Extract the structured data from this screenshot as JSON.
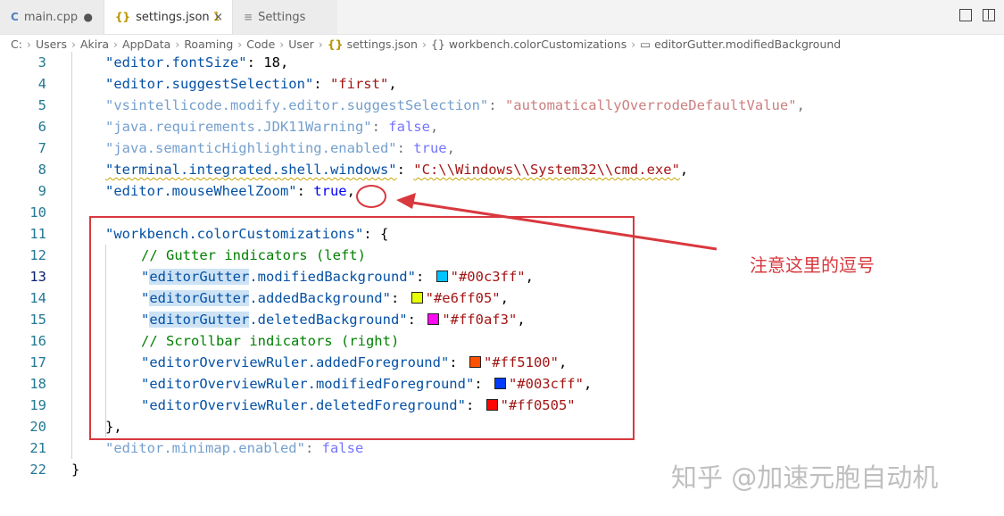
{
  "tabs": [
    {
      "icon": "C",
      "label": "main.cpp",
      "marker": "●"
    },
    {
      "icon": "{}",
      "label": "settings.json",
      "badge": "1",
      "marker": "×"
    },
    {
      "icon": "≡",
      "label": "Settings"
    }
  ],
  "breadcrumb": [
    "C:",
    "Users",
    "Akira",
    "AppData",
    "Roaming",
    "Code",
    "User",
    "settings.json",
    "{} workbench.colorCustomizations",
    "editorGutter.modifiedBackground"
  ],
  "breadcrumb_json_icon": "{}",
  "lines": [
    {
      "num": "3",
      "k": "\"editor.fontSize\"",
      "colon": ": ",
      "v": "18",
      "end": ","
    },
    {
      "num": "4",
      "k": "\"editor.suggestSelection\"",
      "colon": ": ",
      "v": "\"first\"",
      "end": ","
    },
    {
      "num": "5",
      "k": "\"vsintellicode.modify.editor.suggestSelection\"",
      "colon": ": ",
      "v": "\"automaticallyOverrodeDefaultValue\"",
      "end": ","
    },
    {
      "num": "6",
      "k": "\"java.requirements.JDK11Warning\"",
      "colon": ": ",
      "v": "false",
      "end": ","
    },
    {
      "num": "7",
      "k": "\"java.semanticHighlighting.enabled\"",
      "colon": ": ",
      "v": "true",
      "end": ","
    },
    {
      "num": "8",
      "k": "\"terminal.integrated.shell.windows\"",
      "colon": ": ",
      "v": "\"C:\\\\Windows\\\\System32\\\\cmd.exe\"",
      "end": ","
    },
    {
      "num": "9",
      "k": "\"editor.mouseWheelZoom\"",
      "colon": ": ",
      "v": "true",
      "end": ","
    },
    {
      "num": "10"
    },
    {
      "num": "11",
      "k": "\"workbench.colorCustomizations\"",
      "colon": ": ",
      "v": "{"
    },
    {
      "num": "12",
      "comment": "// Gutter indicators (left)"
    },
    {
      "num": "13",
      "q": "\"",
      "hl": "editorGutter",
      "rest": ".modifiedBackground\"",
      "colon": ": ",
      "color": "#00c3ff",
      "v": "\"#00c3ff\"",
      "end": ","
    },
    {
      "num": "14",
      "q": "\"",
      "hl": "editorGutter",
      "rest": ".addedBackground\"",
      "colon": ": ",
      "color": "#e6ff05",
      "v": "\"#e6ff05\"",
      "end": ","
    },
    {
      "num": "15",
      "q": "\"",
      "hl": "editorGutter",
      "rest": ".deletedBackground\"",
      "colon": ": ",
      "color": "#ff0af3",
      "v": "\"#ff0af3\"",
      "end": ","
    },
    {
      "num": "16",
      "comment": "// Scrollbar indicators (right)"
    },
    {
      "num": "17",
      "k": "\"editorOverviewRuler.addedForeground\"",
      "colon": ": ",
      "color": "#ff5100",
      "v": "\"#ff5100\"",
      "end": ","
    },
    {
      "num": "18",
      "k": "\"editorOverviewRuler.modifiedForeground\"",
      "colon": ": ",
      "color": "#003cff",
      "v": "\"#003cff\"",
      "end": ","
    },
    {
      "num": "19",
      "k": "\"editorOverviewRuler.deletedForeground\"",
      "colon": ": ",
      "color": "#ff0505",
      "v": "\"#ff0505\""
    },
    {
      "num": "20",
      "v": "}",
      "end": ","
    },
    {
      "num": "21",
      "k": "\"editor.minimap.enabled\"",
      "colon": ": ",
      "v": "false"
    },
    {
      "num": "22",
      "v": "}"
    }
  ],
  "annotation": "注意这里的逗号",
  "watermark": "知乎 @加速元胞自动机",
  "colors": {
    "annotation": "#d9383e",
    "key": "#0451a5",
    "string": "#a31515",
    "comment": "#008000",
    "keyword": "#0000ff"
  }
}
